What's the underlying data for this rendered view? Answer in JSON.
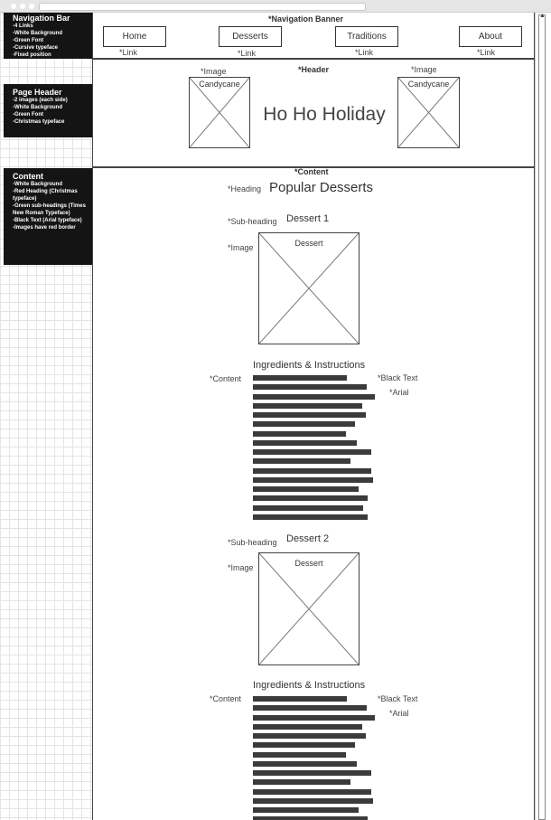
{
  "notes": {
    "nav": {
      "title": "Navigation Bar",
      "items": [
        "-4 Links",
        "-White Background",
        "-Green Font",
        "-Cursive typeface",
        "-Fixed position"
      ]
    },
    "header": {
      "title": "Page Header",
      "items": [
        "-2 images (each side)",
        "-White Background",
        "-Green Font",
        "-Christmas typeface"
      ]
    },
    "content": {
      "title": "Content",
      "items": [
        "-White Background",
        "-Red Heading (Christmas typeface)",
        "-Green sub-headings (Times New Roman Typeface)",
        "-Black Text (Arial typeface)",
        "-Images have red border"
      ]
    }
  },
  "nav_banner": {
    "label": "*Navigation Banner",
    "links": [
      "Home",
      "Desserts",
      "Traditions",
      "About"
    ],
    "link_annotation": "*Link"
  },
  "header": {
    "label": "*Header",
    "image_annotation": "*Image",
    "image_caption": "Candycane",
    "title": "Ho Ho Holiday"
  },
  "content": {
    "label": "*Content",
    "heading_annotation": "*Heading",
    "heading": "Popular Desserts",
    "subheading_annotation": "*Sub-heading",
    "image_annotation": "*Image",
    "content_annotation": "*Content",
    "black_text_annotation": "*Black Text",
    "arial_annotation": "*Arial",
    "section_title": "Ingredients & Instructions",
    "image_caption": "Dessert",
    "desserts": [
      {
        "subheading": "Dessert 1"
      },
      {
        "subheading": "Dessert 2"
      }
    ]
  }
}
